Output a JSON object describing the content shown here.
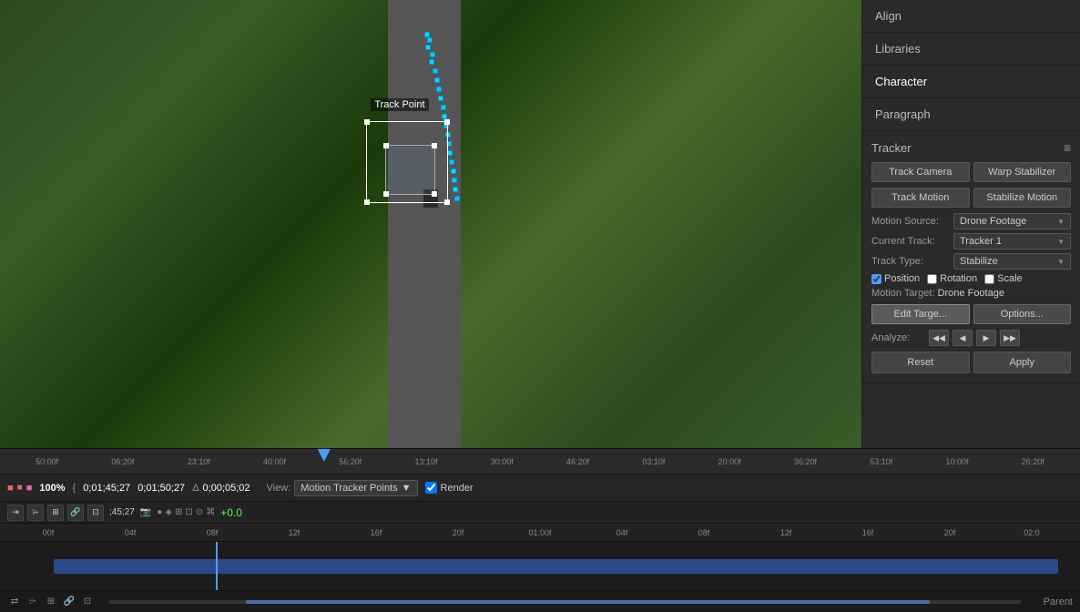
{
  "panels": {
    "align_label": "Align",
    "libraries_label": "Libraries",
    "character_label": "Character",
    "paragraph_label": "Paragraph"
  },
  "tracker": {
    "title": "Tracker",
    "track_camera_btn": "Track Camera",
    "warp_stabilizer_btn": "Warp Stabilizer",
    "track_motion_btn": "Track Motion",
    "stabilize_motion_btn": "Stabilize Motion",
    "motion_source_label": "Motion Source:",
    "motion_source_value": "Drone Footage",
    "current_track_label": "Current Track:",
    "current_track_value": "Tracker 1",
    "track_type_label": "Track Type:",
    "track_type_value": "Stabilize",
    "position_label": "Position",
    "rotation_label": "Rotation",
    "scale_label": "Scale",
    "motion_target_label": "Motion Target:",
    "motion_target_value": "Drone Footage",
    "edit_target_btn": "Edit Targe...",
    "options_btn": "Options...",
    "analyze_label": "Analyze:",
    "reset_btn": "Reset",
    "apply_btn": "Apply"
  },
  "timeline": {
    "ruler_marks": [
      "50:00f",
      "06:20f",
      "23:10f",
      "40:00f",
      "56:20f",
      "13:10f",
      "30:00f",
      "46:20f",
      "03:10f",
      "20:00f",
      "36:20f",
      "53:10f",
      "10:00f",
      "26:20f"
    ],
    "track_ruler_marks": [
      "00f",
      "04f",
      "08f",
      "12f",
      "16f",
      "20f",
      "01:00f",
      "04f",
      "08f",
      "12f",
      "16f",
      "20f",
      "02:0"
    ],
    "zoom_level": "100%",
    "current_time": "0;01;45;27",
    "end_time": "0;01;50;27",
    "delta_time": "0;00;05;02",
    "view_label": "View:",
    "view_value": "Motion Tracker Points",
    "render_label": "Render",
    "time_left": ";45;27",
    "parent_label": "Parent",
    "offset_value": "+0.0"
  },
  "trackpoint": {
    "label": "Track Point"
  }
}
